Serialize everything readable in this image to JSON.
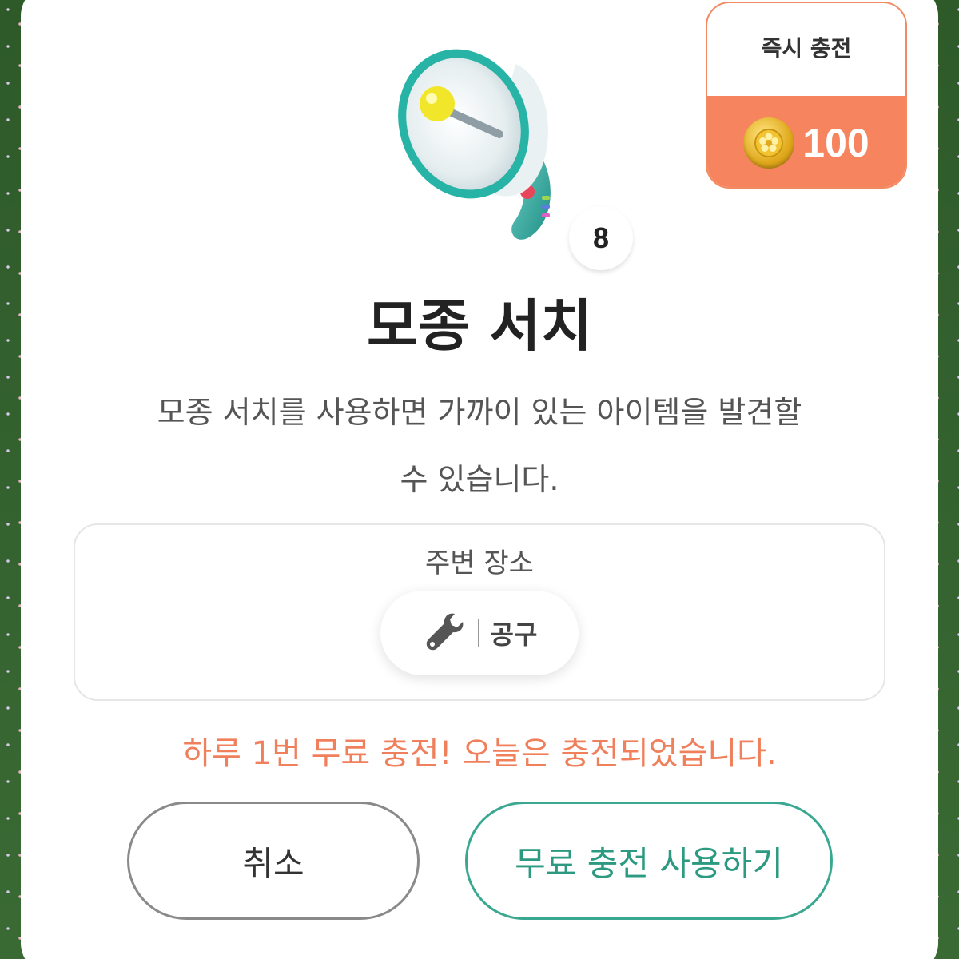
{
  "charge": {
    "title": "즉시 충전",
    "amount": "100",
    "coin_icon": "coin-icon",
    "accent": "#f5845f"
  },
  "item": {
    "icon": "megaphone-icon",
    "count": "8",
    "name": "모종 서치",
    "description_line1": "모종 서치를 사용하면 가까이 있는 아이템을  발견할",
    "description_line2": "수 있습니다."
  },
  "nearby": {
    "label": "주변 장소",
    "chip_icon": "wrench-icon",
    "chip_label": "공구"
  },
  "notice": {
    "text": "하루 1번 무료 충전! 오늘은 충전되었습니다.",
    "color": "#f0805c"
  },
  "buttons": {
    "cancel_label": "취소",
    "use_label": "무료 충전 사용하기",
    "use_color": "#2b9a80"
  }
}
